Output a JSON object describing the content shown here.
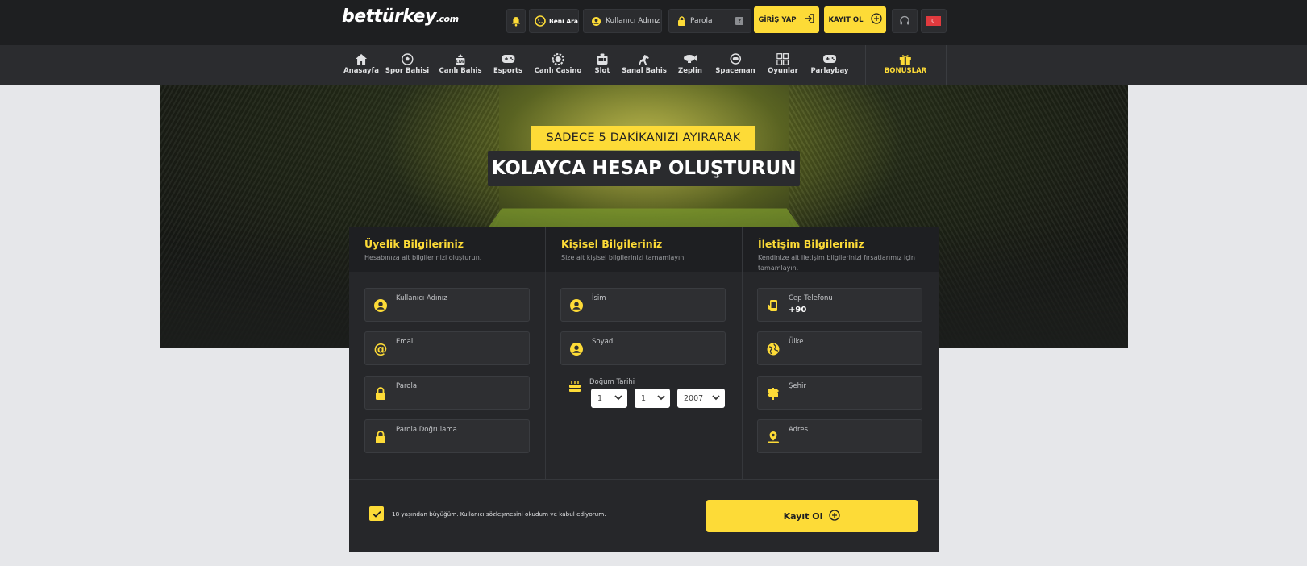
{
  "header": {
    "logo_main": "bettürkey",
    "logo_suffix": ".com",
    "beni_ara": "Beni Ara",
    "username_placeholder": "Kullanıcı Adınız",
    "password_placeholder": "Parola",
    "password_help": "?",
    "login_label": "GİRİŞ YAP",
    "register_label": "KAYIT OL",
    "language_flag": "TR"
  },
  "nav": {
    "items": [
      {
        "label": "Anasayfa",
        "icon": "home-icon"
      },
      {
        "label": "Spor Bahisi",
        "icon": "soccer-ball-icon"
      },
      {
        "label": "Canlı Bahis",
        "icon": "live-bet-icon"
      },
      {
        "label": "Esports",
        "icon": "gamepad-icon"
      },
      {
        "label": "Canlı Casino",
        "icon": "casino-chip-icon"
      },
      {
        "label": "Slot",
        "icon": "slot-machine-icon"
      },
      {
        "label": "Sanal Bahis",
        "icon": "horse-icon"
      },
      {
        "label": "Zeplin",
        "icon": "zeppelin-icon"
      },
      {
        "label": "Spaceman",
        "icon": "spaceman-icon"
      },
      {
        "label": "Oyunlar",
        "icon": "grid-icon"
      },
      {
        "label": "Parlaybay",
        "icon": "gamepad-icon"
      }
    ],
    "bonus_label": "BONUSLAR"
  },
  "hero": {
    "subtitle": "SADECE 5 DAKİKANIZI AYIRARAK",
    "title": "KOLAYCA HESAP OLUŞTURUN"
  },
  "form": {
    "membership": {
      "title": "Üyelik Bilgileriniz",
      "desc": "Hesabınıza ait bilgilerinizi oluşturun.",
      "fields": [
        "Kullanıcı Adınız",
        "Email",
        "Parola",
        "Parola Doğrulama"
      ]
    },
    "personal": {
      "title": "Kişisel Bilgileriniz",
      "desc": "Size ait kişisel bilgilerinizi tamamlayın.",
      "name": "İsim",
      "surname": "Soyad",
      "dob_label": "Doğum Tarihi",
      "dob_day": "1",
      "dob_month": "1",
      "dob_year": "2007"
    },
    "contact": {
      "title": "İletişim Bilgileriniz",
      "desc_line1": "Kendinize ait iletişim bilgilerinizi fırsatlarımız için",
      "desc_line2": "tamamlayın.",
      "phone_label": "Cep Telefonu",
      "phone_prefix": "+90",
      "country": "Ülke",
      "city": "Şehir",
      "address": "Adres"
    },
    "terms": "18 yaşından büyüğüm. Kullanıcı sözleşmesini okudum ve kabul ediyorum.",
    "terms_checked": true,
    "submit_label": "Kayıt Ol"
  },
  "colors": {
    "accent": "#fddb37",
    "topbar": "#1e1f21",
    "navbar": "#2b2c2f",
    "panel": "#26272a",
    "page_bg": "#e6e7ea"
  }
}
